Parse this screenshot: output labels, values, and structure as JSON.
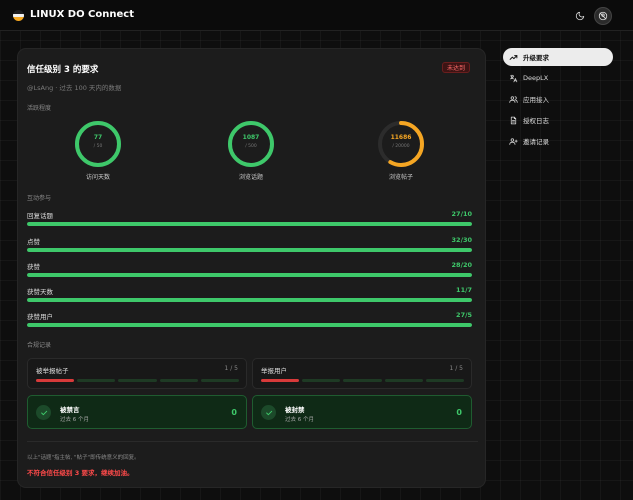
{
  "app": {
    "title": "LINUX DO Connect"
  },
  "card": {
    "title": "信任级别 3 的要求",
    "badge": "未达到",
    "subtitle": "@LsAng · 过去 100 天内的数据",
    "activity_label": "活跃程度",
    "rings": [
      {
        "value": "77",
        "max": "/ 50",
        "label": "访问天数",
        "fraction": 1.0,
        "color": "#3ec86a"
      },
      {
        "value": "1087",
        "max": "/ 500",
        "label": "浏览话题",
        "fraction": 1.0,
        "color": "#3ec86a"
      },
      {
        "value": "11686",
        "max": "/ 20000",
        "label": "浏览帖子",
        "fraction": 0.584,
        "color": "#f5a623"
      }
    ],
    "interaction_label": "互动参与",
    "bars": [
      {
        "name": "回复话题",
        "value": "27/10",
        "fraction": 1.0
      },
      {
        "name": "点赞",
        "value": "32/30",
        "fraction": 1.0
      },
      {
        "name": "获赞",
        "value": "28/20",
        "fraction": 1.0
      },
      {
        "name": "获赞天数",
        "value": "11/7",
        "fraction": 1.0
      },
      {
        "name": "获赞用户",
        "value": "27/5",
        "fraction": 1.0
      }
    ],
    "compliance_label": "合规记录",
    "violations": [
      {
        "name": "被举报帖子",
        "count": "1 / 5",
        "filled": 1,
        "total": 5
      },
      {
        "name": "举报用户",
        "count": "1 / 5",
        "filled": 1,
        "total": 5
      }
    ],
    "statuses": [
      {
        "title": "被禁言",
        "sub": "过去 6 个月",
        "value": "0"
      },
      {
        "title": "被封禁",
        "sub": "过去 6 个月",
        "value": "0"
      }
    ],
    "note": "以上\"话题\"指主帖, \"帖子\"即传统意义的回复。",
    "result": "不符合信任级别 3 要求，继续加油。"
  },
  "sidebar": {
    "items": [
      {
        "label": "升级要求",
        "icon": "trending-up-icon",
        "active": true
      },
      {
        "label": "DeepLX",
        "icon": "translate-icon",
        "active": false
      },
      {
        "label": "应用接入",
        "icon": "users-icon",
        "active": false
      },
      {
        "label": "授权日志",
        "icon": "document-icon",
        "active": false
      },
      {
        "label": "邀请记录",
        "icon": "user-add-icon",
        "active": false
      }
    ]
  },
  "colors": {
    "accent_green": "#3ec86a",
    "accent_orange": "#f5a623",
    "danger_red": "#ff4a4a"
  }
}
